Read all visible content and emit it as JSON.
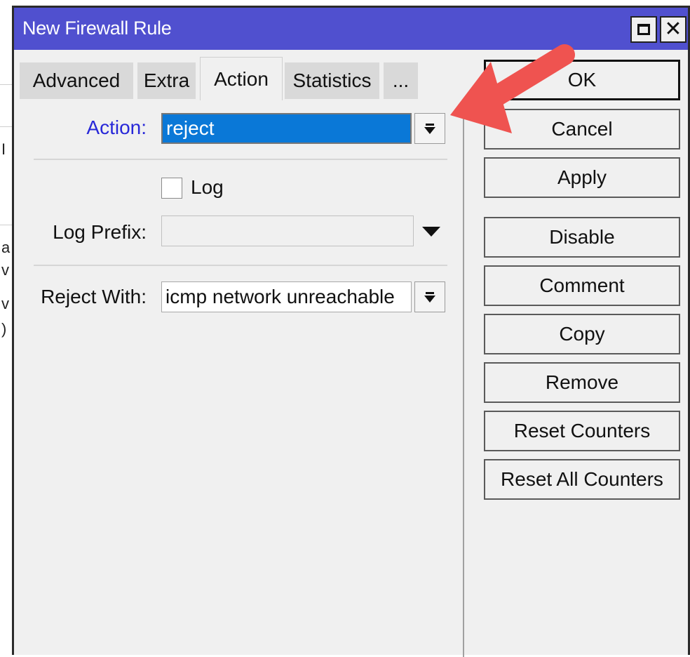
{
  "window": {
    "title": "New Firewall Rule"
  },
  "tabs": [
    {
      "label": "Advanced",
      "active": false
    },
    {
      "label": "Extra",
      "active": false
    },
    {
      "label": "Action",
      "active": true
    },
    {
      "label": "Statistics",
      "active": false
    },
    {
      "label": "...",
      "active": false
    }
  ],
  "form": {
    "action_label": "Action:",
    "action_value": "reject",
    "log_label": "Log",
    "log_checked": false,
    "log_prefix_label": "Log Prefix:",
    "log_prefix_value": "",
    "reject_with_label": "Reject With:",
    "reject_with_value": "icmp network unreachable"
  },
  "buttons": {
    "ok": "OK",
    "cancel": "Cancel",
    "apply": "Apply",
    "disable": "Disable",
    "comment": "Comment",
    "copy": "Copy",
    "remove": "Remove",
    "reset_counters": "Reset Counters",
    "reset_all_counters": "Reset All Counters"
  },
  "colors": {
    "titlebar": "#5050cf",
    "selection": "#0a78d7",
    "annotation_arrow": "#ef5350",
    "action_label": "#2828d8"
  },
  "icons": [
    "maximize-icon",
    "close-icon",
    "dropdown-arrow-icon",
    "annotation-arrow-icon"
  ]
}
